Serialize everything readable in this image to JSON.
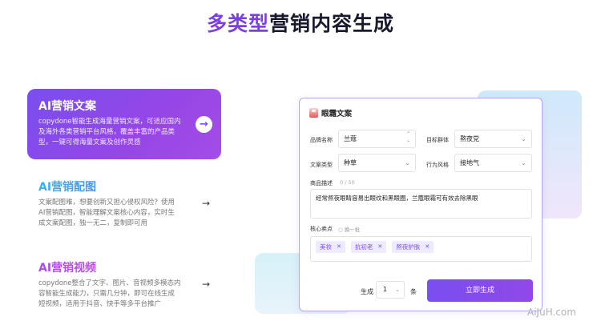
{
  "header": {
    "title_accent": "多类型",
    "title_rest": "营销内容生成"
  },
  "features": [
    {
      "title": "AI营销文案",
      "desc": "copydone智能生成海量营销文案，可适应国内及海外各类营销平台风格，覆盖丰富的产品类型，一键可得海量文案及创作灵感",
      "arrow": "→"
    },
    {
      "title": "AI营销配图",
      "desc": "文案配图难，想要创新又担心侵权风险？使用AI营销配图，智能理解文案核心内容，实时生成文案配图，独一无二，复制即可用",
      "arrow": "→"
    },
    {
      "title": "AI营销视频",
      "desc": "copydone整合了文字、图片、音视频多模态内容智能生成能力，只需几分钟，即可在线生成短视频，适用于抖音、快手等多平台推广",
      "arrow": "→"
    }
  ],
  "form": {
    "title": "眼霜文案",
    "brand_label": "品牌名称",
    "brand_value": "兰蔻",
    "audience_label": "目标群体",
    "audience_value": "熬夜党",
    "copytype_label": "文案类型",
    "copytype_value": "种草",
    "style_label": "行为风格",
    "style_value": "接地气",
    "desc_label": "商品描述",
    "desc_counter": "0 / 50",
    "desc_value": "经常熬夜眼睛容易出眼纹和黑眼圈，兰蔻眼霜可有效去除黑眼",
    "selling_label": "核心卖点",
    "refresh_label": "换一批",
    "tags": [
      "美妆",
      "抗初老",
      "熬夜护肤"
    ],
    "generate_label": "生成",
    "count_value": "1",
    "unit_label": "条",
    "submit_label": "立即生成"
  },
  "watermark": "AiJuH.com",
  "colors": {
    "accent": "#7b3fe4",
    "button": "#7a4ef0"
  },
  "icons": {
    "arrow": "arrow-right-icon",
    "eye_cream": "eye-cream-icon",
    "refresh": "refresh-icon",
    "tag_close": "close-icon"
  }
}
